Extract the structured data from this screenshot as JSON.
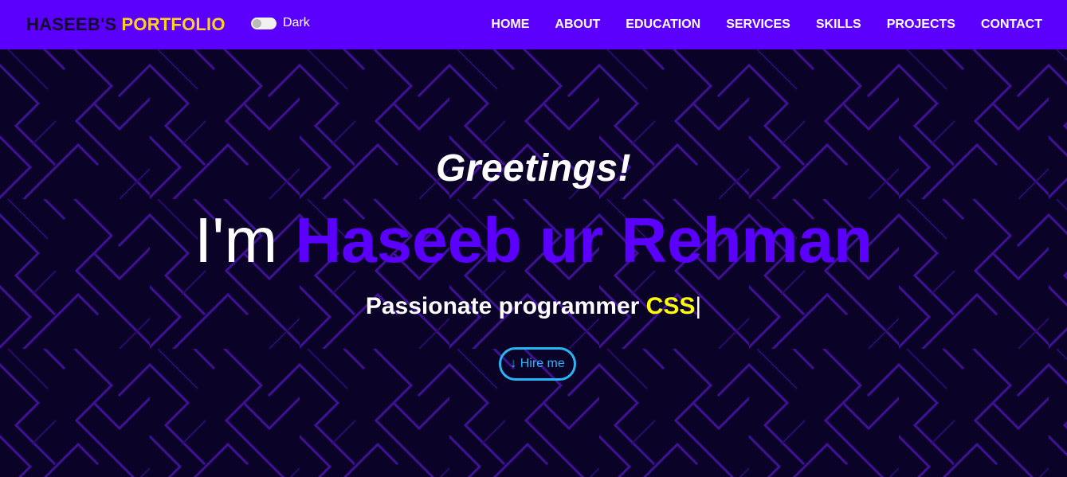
{
  "brand": {
    "first": "HASEEB'S",
    "second": "PORTFOLIO"
  },
  "theme_toggle": {
    "label": "Dark",
    "enabled": false
  },
  "nav": {
    "items": [
      {
        "label": "HOME"
      },
      {
        "label": "ABOUT"
      },
      {
        "label": "EDUCATION"
      },
      {
        "label": "SERVICES"
      },
      {
        "label": "SKILLS"
      },
      {
        "label": "PROJECTS"
      },
      {
        "label": "CONTACT"
      }
    ]
  },
  "hero": {
    "greeting": "Greetings!",
    "intro_prefix": "I'm",
    "name": "Haseeb ur Rehman",
    "tagline_prefix": "Passionate programmer",
    "tagline_typed": "CSS",
    "cursor": "|",
    "hire_button": {
      "arrow_icon": "arrow-down-icon",
      "arrow": "↓",
      "label": "Hire me"
    }
  },
  "colors": {
    "navbar": "#5b00ff",
    "brand_first": "#12062e",
    "brand_second": "#ffd21f",
    "hero_background": "#0b0228",
    "name_accent": "#5b00ff",
    "typed_accent": "#ffff00",
    "button_accent": "#29b6f6",
    "pattern_line": "#3e1196"
  }
}
